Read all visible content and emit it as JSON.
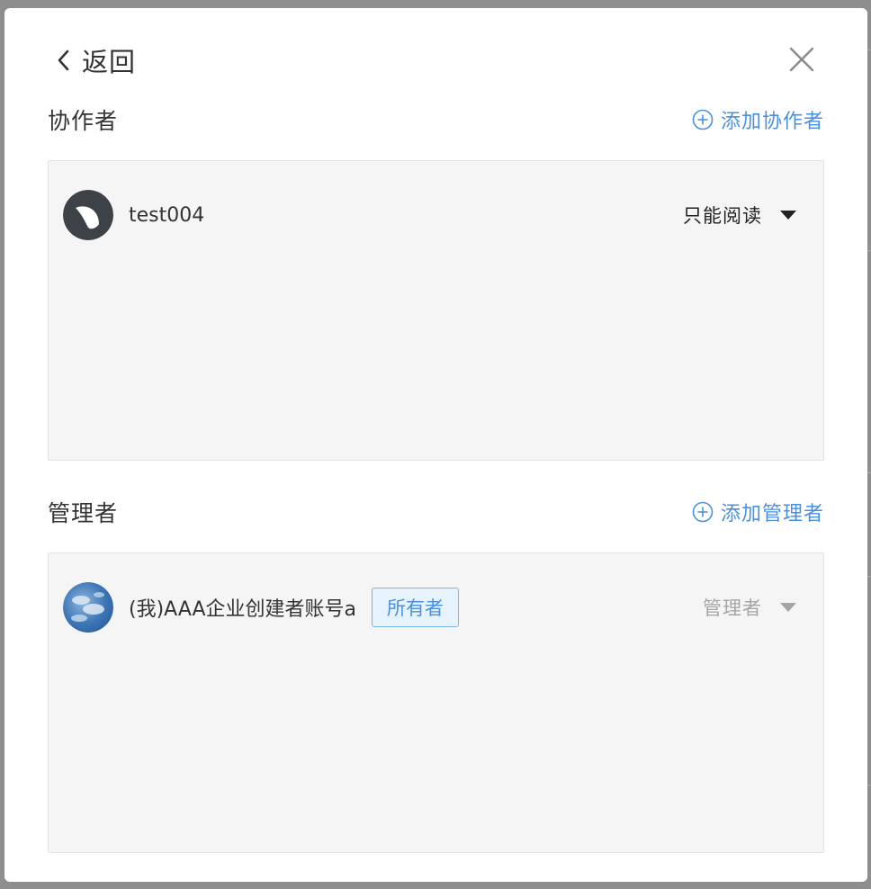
{
  "header": {
    "back_label": "返回",
    "back_icon": "chevron-left-icon",
    "close_icon": "close-icon"
  },
  "collaborators": {
    "title": "协作者",
    "add_label": "添加协作者",
    "add_icon": "plus-circle-icon",
    "members": [
      {
        "name": "test004",
        "role": "只能阅读",
        "avatar": "dark-leaf-avatar"
      }
    ]
  },
  "managers": {
    "title": "管理者",
    "add_label": "添加管理者",
    "add_icon": "plus-circle-icon",
    "members": [
      {
        "name": "(我)AAA企业创建者账号a",
        "badge": "所有者",
        "role": "管理者",
        "avatar": "sky-photo-avatar"
      }
    ]
  },
  "colors": {
    "accent": "#4a90e2",
    "panel_bg": "#f5f5f5",
    "badge_bg": "#e6f2fc",
    "disabled_text": "#a5a5a5"
  }
}
